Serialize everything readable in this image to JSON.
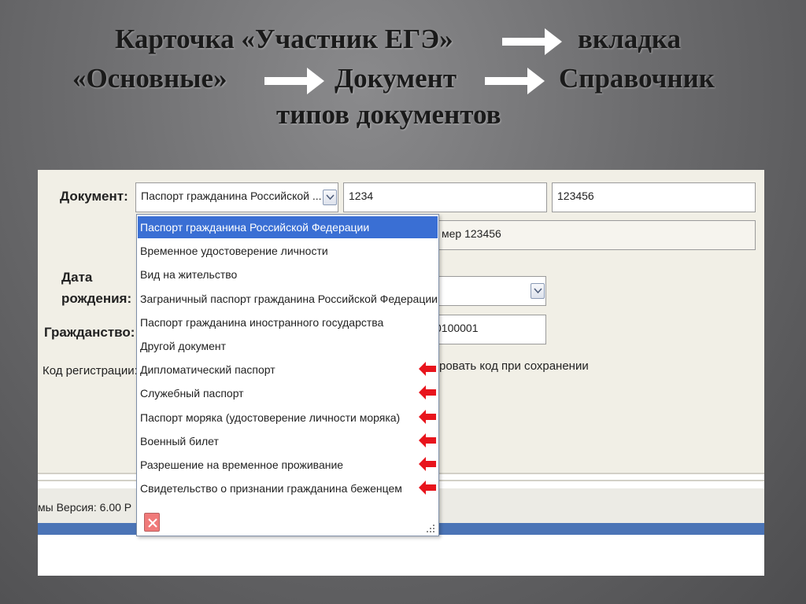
{
  "slide": {
    "title_line1": "Карточка «Участник ЕГЭ»",
    "title_line1_end": "вкладка",
    "title_line2_a": "«Основные»",
    "title_line2_b": "Документ",
    "title_line2_c": "Справочник",
    "title_line3": "типов документов"
  },
  "form": {
    "document_label": "Документ:",
    "document_type_value": "Паспорт гражданина Российской ...",
    "series_value": "1234",
    "number_value": "123456",
    "doc_summary_value": "мер 123456",
    "birth_label_line1": "Дата",
    "birth_label_line2": "рождения:",
    "citizenship_label": "Гражданство:",
    "citizenship_code_value": "0100001",
    "reg_code_label": "Код регистрации:",
    "reg_code_checkbox_text": "ровать код при сохранении"
  },
  "status_bar": {
    "text": "мы  Версия: 6.00  Р"
  },
  "dropdown": {
    "items": [
      {
        "label": "Паспорт гражданина Российской Федерации",
        "selected": true,
        "marked": false
      },
      {
        "label": "Временное удостоверение личности",
        "selected": false,
        "marked": false
      },
      {
        "label": "Вид на жительство",
        "selected": false,
        "marked": false
      },
      {
        "label": "Заграничный паспорт гражданина Российской Федерации",
        "selected": false,
        "marked": false
      },
      {
        "label": "Паспорт гражданина иностранного государства",
        "selected": false,
        "marked": false
      },
      {
        "label": "Другой документ",
        "selected": false,
        "marked": false
      },
      {
        "label": "Дипломатический паспорт",
        "selected": false,
        "marked": true
      },
      {
        "label": "Служебный паспорт",
        "selected": false,
        "marked": true
      },
      {
        "label": "Паспорт моряка (удостоверение личности моряка)",
        "selected": false,
        "marked": true
      },
      {
        "label": "Военный билет",
        "selected": false,
        "marked": true
      },
      {
        "label": "Разрешение на временное проживание",
        "selected": false,
        "marked": true
      },
      {
        "label": "Свидетельство о признании гражданина беженцем",
        "selected": false,
        "marked": true
      }
    ]
  },
  "colors": {
    "selection": "#3a6fd4",
    "marker_arrow": "#e8141c",
    "status_band": "#4b74b6"
  }
}
